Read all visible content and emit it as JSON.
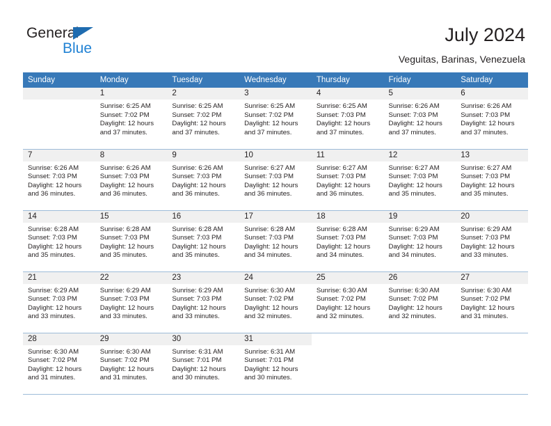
{
  "brand": {
    "name_dark": "General",
    "name_blue": "Blue",
    "accent_blue": "#2182d4",
    "triangle_blue": "#1f6cb0"
  },
  "header": {
    "title": "July 2024",
    "location": "Veguitas, Barinas, Venezuela",
    "header_bg": "#3879b8",
    "daynum_bg": "#f0f0f0",
    "grid_line": "#9dbbd8"
  },
  "weekday_headers": [
    "Sunday",
    "Monday",
    "Tuesday",
    "Wednesday",
    "Thursday",
    "Friday",
    "Saturday"
  ],
  "weeks": [
    [
      {
        "day": "",
        "lines": []
      },
      {
        "day": "1",
        "lines": [
          "Sunrise: 6:25 AM",
          "Sunset: 7:02 PM",
          "Daylight: 12 hours",
          "and 37 minutes."
        ]
      },
      {
        "day": "2",
        "lines": [
          "Sunrise: 6:25 AM",
          "Sunset: 7:02 PM",
          "Daylight: 12 hours",
          "and 37 minutes."
        ]
      },
      {
        "day": "3",
        "lines": [
          "Sunrise: 6:25 AM",
          "Sunset: 7:02 PM",
          "Daylight: 12 hours",
          "and 37 minutes."
        ]
      },
      {
        "day": "4",
        "lines": [
          "Sunrise: 6:25 AM",
          "Sunset: 7:03 PM",
          "Daylight: 12 hours",
          "and 37 minutes."
        ]
      },
      {
        "day": "5",
        "lines": [
          "Sunrise: 6:26 AM",
          "Sunset: 7:03 PM",
          "Daylight: 12 hours",
          "and 37 minutes."
        ]
      },
      {
        "day": "6",
        "lines": [
          "Sunrise: 6:26 AM",
          "Sunset: 7:03 PM",
          "Daylight: 12 hours",
          "and 37 minutes."
        ]
      }
    ],
    [
      {
        "day": "7",
        "lines": [
          "Sunrise: 6:26 AM",
          "Sunset: 7:03 PM",
          "Daylight: 12 hours",
          "and 36 minutes."
        ]
      },
      {
        "day": "8",
        "lines": [
          "Sunrise: 6:26 AM",
          "Sunset: 7:03 PM",
          "Daylight: 12 hours",
          "and 36 minutes."
        ]
      },
      {
        "day": "9",
        "lines": [
          "Sunrise: 6:26 AM",
          "Sunset: 7:03 PM",
          "Daylight: 12 hours",
          "and 36 minutes."
        ]
      },
      {
        "day": "10",
        "lines": [
          "Sunrise: 6:27 AM",
          "Sunset: 7:03 PM",
          "Daylight: 12 hours",
          "and 36 minutes."
        ]
      },
      {
        "day": "11",
        "lines": [
          "Sunrise: 6:27 AM",
          "Sunset: 7:03 PM",
          "Daylight: 12 hours",
          "and 36 minutes."
        ]
      },
      {
        "day": "12",
        "lines": [
          "Sunrise: 6:27 AM",
          "Sunset: 7:03 PM",
          "Daylight: 12 hours",
          "and 35 minutes."
        ]
      },
      {
        "day": "13",
        "lines": [
          "Sunrise: 6:27 AM",
          "Sunset: 7:03 PM",
          "Daylight: 12 hours",
          "and 35 minutes."
        ]
      }
    ],
    [
      {
        "day": "14",
        "lines": [
          "Sunrise: 6:28 AM",
          "Sunset: 7:03 PM",
          "Daylight: 12 hours",
          "and 35 minutes."
        ]
      },
      {
        "day": "15",
        "lines": [
          "Sunrise: 6:28 AM",
          "Sunset: 7:03 PM",
          "Daylight: 12 hours",
          "and 35 minutes."
        ]
      },
      {
        "day": "16",
        "lines": [
          "Sunrise: 6:28 AM",
          "Sunset: 7:03 PM",
          "Daylight: 12 hours",
          "and 35 minutes."
        ]
      },
      {
        "day": "17",
        "lines": [
          "Sunrise: 6:28 AM",
          "Sunset: 7:03 PM",
          "Daylight: 12 hours",
          "and 34 minutes."
        ]
      },
      {
        "day": "18",
        "lines": [
          "Sunrise: 6:28 AM",
          "Sunset: 7:03 PM",
          "Daylight: 12 hours",
          "and 34 minutes."
        ]
      },
      {
        "day": "19",
        "lines": [
          "Sunrise: 6:29 AM",
          "Sunset: 7:03 PM",
          "Daylight: 12 hours",
          "and 34 minutes."
        ]
      },
      {
        "day": "20",
        "lines": [
          "Sunrise: 6:29 AM",
          "Sunset: 7:03 PM",
          "Daylight: 12 hours",
          "and 33 minutes."
        ]
      }
    ],
    [
      {
        "day": "21",
        "lines": [
          "Sunrise: 6:29 AM",
          "Sunset: 7:03 PM",
          "Daylight: 12 hours",
          "and 33 minutes."
        ]
      },
      {
        "day": "22",
        "lines": [
          "Sunrise: 6:29 AM",
          "Sunset: 7:03 PM",
          "Daylight: 12 hours",
          "and 33 minutes."
        ]
      },
      {
        "day": "23",
        "lines": [
          "Sunrise: 6:29 AM",
          "Sunset: 7:03 PM",
          "Daylight: 12 hours",
          "and 33 minutes."
        ]
      },
      {
        "day": "24",
        "lines": [
          "Sunrise: 6:30 AM",
          "Sunset: 7:02 PM",
          "Daylight: 12 hours",
          "and 32 minutes."
        ]
      },
      {
        "day": "25",
        "lines": [
          "Sunrise: 6:30 AM",
          "Sunset: 7:02 PM",
          "Daylight: 12 hours",
          "and 32 minutes."
        ]
      },
      {
        "day": "26",
        "lines": [
          "Sunrise: 6:30 AM",
          "Sunset: 7:02 PM",
          "Daylight: 12 hours",
          "and 32 minutes."
        ]
      },
      {
        "day": "27",
        "lines": [
          "Sunrise: 6:30 AM",
          "Sunset: 7:02 PM",
          "Daylight: 12 hours",
          "and 31 minutes."
        ]
      }
    ],
    [
      {
        "day": "28",
        "lines": [
          "Sunrise: 6:30 AM",
          "Sunset: 7:02 PM",
          "Daylight: 12 hours",
          "and 31 minutes."
        ]
      },
      {
        "day": "29",
        "lines": [
          "Sunrise: 6:30 AM",
          "Sunset: 7:02 PM",
          "Daylight: 12 hours",
          "and 31 minutes."
        ]
      },
      {
        "day": "30",
        "lines": [
          "Sunrise: 6:31 AM",
          "Sunset: 7:01 PM",
          "Daylight: 12 hours",
          "and 30 minutes."
        ]
      },
      {
        "day": "31",
        "lines": [
          "Sunrise: 6:31 AM",
          "Sunset: 7:01 PM",
          "Daylight: 12 hours",
          "and 30 minutes."
        ]
      },
      {
        "day": "",
        "lines": []
      },
      {
        "day": "",
        "lines": []
      },
      {
        "day": "",
        "lines": []
      }
    ]
  ]
}
